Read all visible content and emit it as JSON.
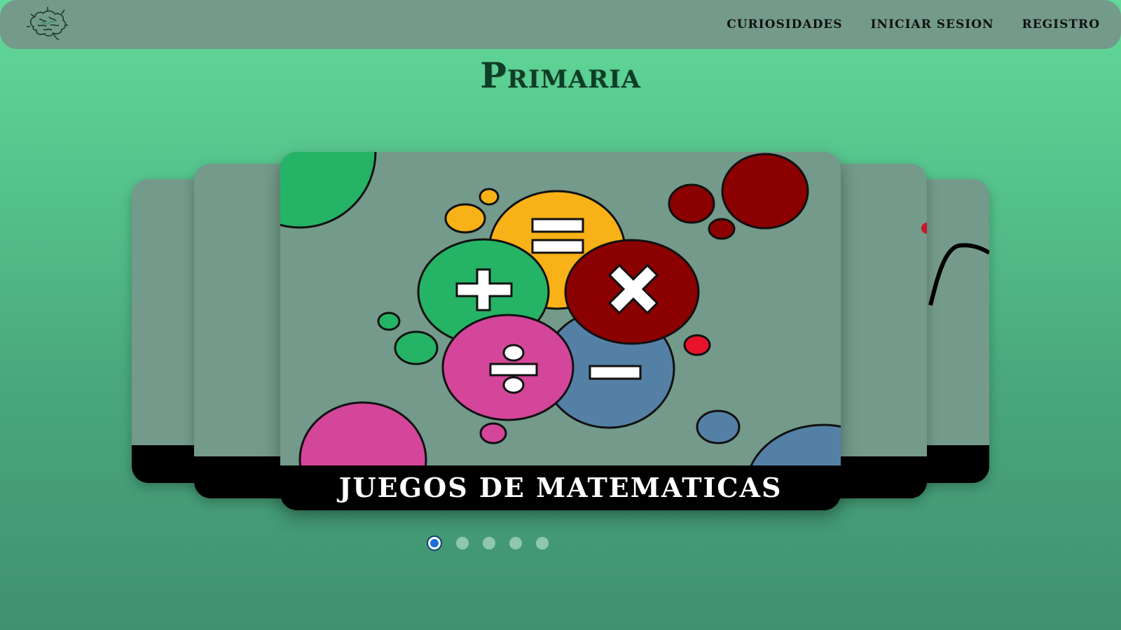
{
  "nav": {
    "logo_icon": "brain-icon",
    "links": [
      {
        "label": "CURIOSIDADES"
      },
      {
        "label": "INICIAR SESION"
      },
      {
        "label": "REGISTRO"
      }
    ]
  },
  "page": {
    "title": "Primaria"
  },
  "carousel": {
    "active_index": 0,
    "slides_count": 5,
    "current_slide": {
      "caption": "JUEGOS DE MATEMATICAS",
      "image_icon": "math-operations-illustration"
    }
  },
  "colors": {
    "navbar": "#739a8a",
    "card": "#739a8a",
    "caption_bg": "#000000",
    "title": "#0f3d27",
    "dot_active": "#1a6fd6",
    "dot_inactive": "#8fc7ae"
  }
}
